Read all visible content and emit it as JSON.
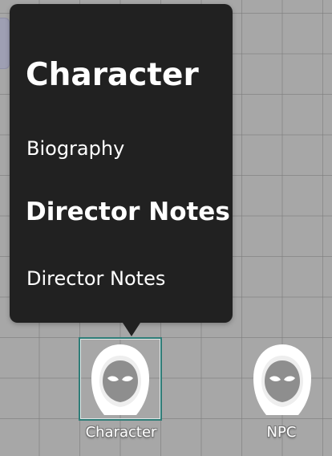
{
  "popup": {
    "title": "Character",
    "items": [
      {
        "label": "Biography",
        "bold": false
      },
      {
        "label": "Director Notes",
        "bold": true
      },
      {
        "label": "Director Notes",
        "bold": false
      }
    ]
  },
  "tokens": [
    {
      "label": "Character",
      "icon": "hooded-figure-icon",
      "selected": true
    },
    {
      "label": "NPC",
      "icon": "hooded-figure-icon",
      "selected": false
    }
  ],
  "colors": {
    "popup_background": "#212121",
    "selection_border": "#2f7d78",
    "canvas_background": "#a7a7a7"
  }
}
